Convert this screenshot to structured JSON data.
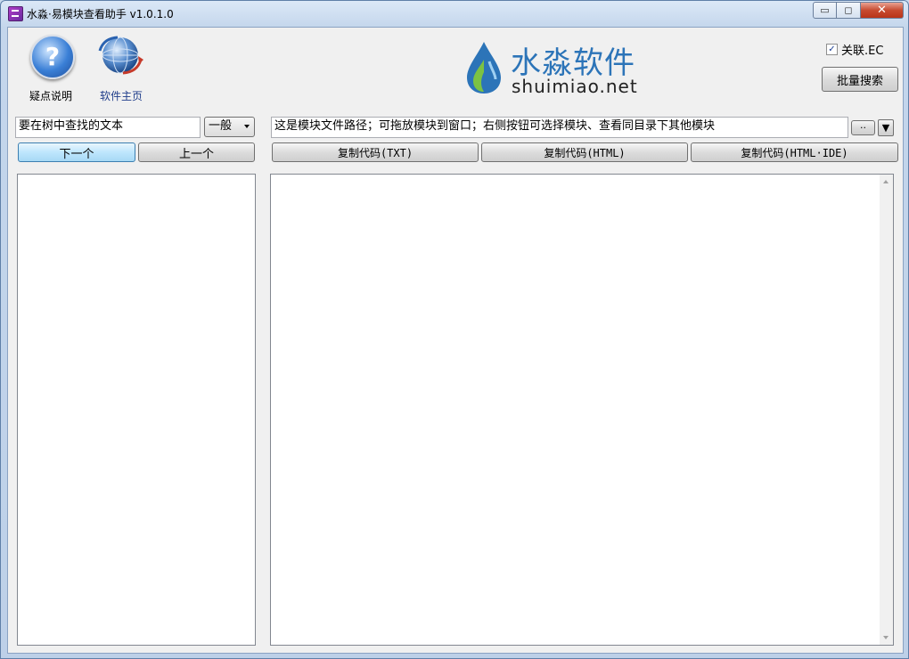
{
  "window": {
    "title": "水淼·易模块查看助手 v1.0.1.0",
    "controls": {
      "minimize": "▭",
      "maximize": "◻",
      "close": "✕"
    }
  },
  "toolbar": {
    "help_label": "疑点说明",
    "help_glyph": "?",
    "homepage_label": "软件主页",
    "logo_cn": "水淼软件",
    "logo_en": "shuimiao.net",
    "ec_checkbox_label": "关联.EC",
    "ec_checked": true,
    "batch_search_label": "批量搜索"
  },
  "search": {
    "input_value": "要在树中查找的文本",
    "mode_selected": "一般",
    "next_label": "下一个",
    "prev_label": "上一个"
  },
  "module": {
    "path_value": "这是模块文件路径；可拖放模块到窗口；右侧按钮可选择模块、查看同目录下其他模块",
    "browse_label": "··",
    "dropdown_glyph": "▼",
    "copy_txt_label": "复制代码(TXT)",
    "copy_html_label": "复制代码(HTML)",
    "copy_html_ide_label": "复制代码(HTML·IDE)"
  },
  "colors": {
    "logo_blue": "#2c74b8",
    "logo_green": "#7cc243",
    "close_red": "#c74b30"
  }
}
